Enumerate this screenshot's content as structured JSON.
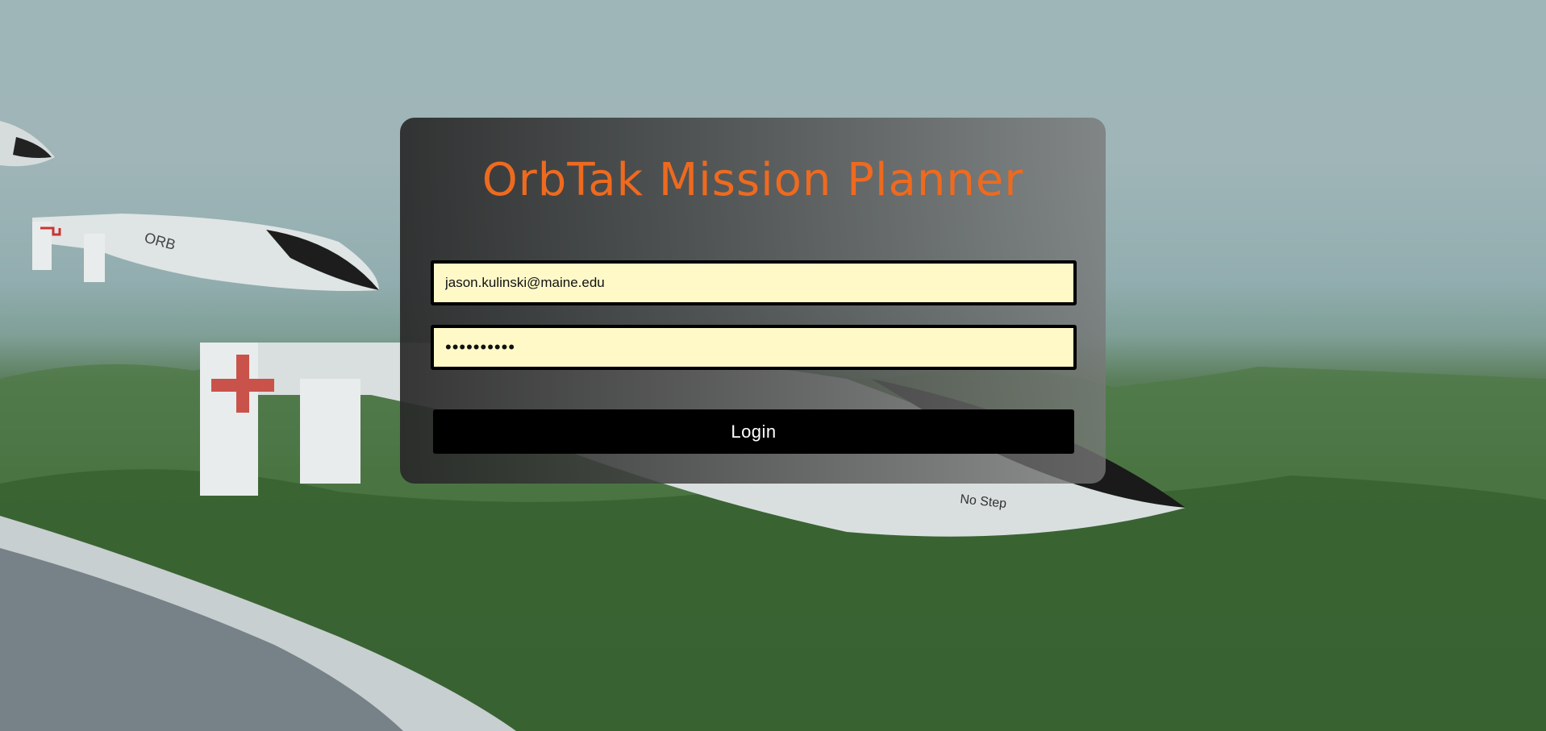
{
  "app": {
    "title": "OrbTak Mission Planner"
  },
  "login": {
    "email_value": "jason.kulinski@maine.edu",
    "password_value": "••••••••••",
    "button_label": "Login"
  },
  "background": {
    "aircraft_text": "No Step",
    "aircraft_logo": "ORB"
  },
  "colors": {
    "title": "#ee6a1f",
    "field_bg": "#fff9c8",
    "button_bg": "#000000"
  }
}
